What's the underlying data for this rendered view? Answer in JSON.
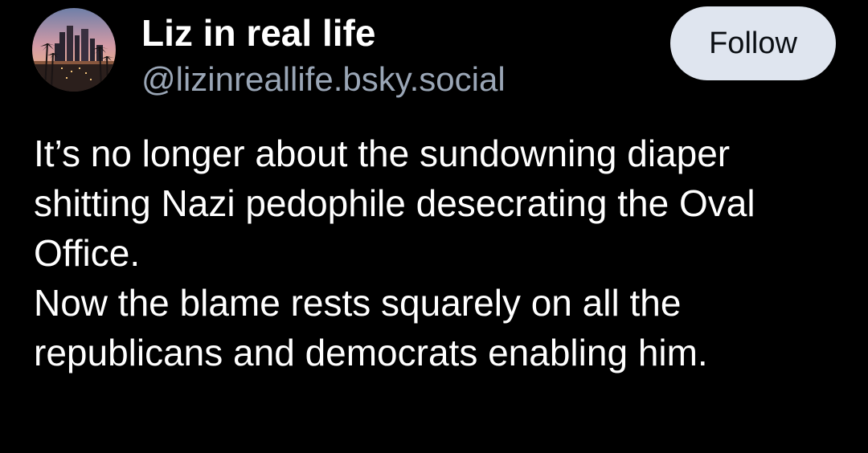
{
  "author": {
    "display_name": "Liz in real life",
    "handle": "@lizinreallife.bsky.social",
    "avatar_icon": "city-skyline-palm-trees-avatar"
  },
  "follow_button": {
    "label": "Follow"
  },
  "post": {
    "text": "It’s no longer about the sundowning diaper shitting Nazi pedophile desecrating the Oval Office.\nNow the blame rests squarely on all the republicans and democrats enabling him."
  },
  "colors": {
    "background": "#000000",
    "handle": "#9aa6b6",
    "follow_button_bg": "#dfe5ef"
  }
}
